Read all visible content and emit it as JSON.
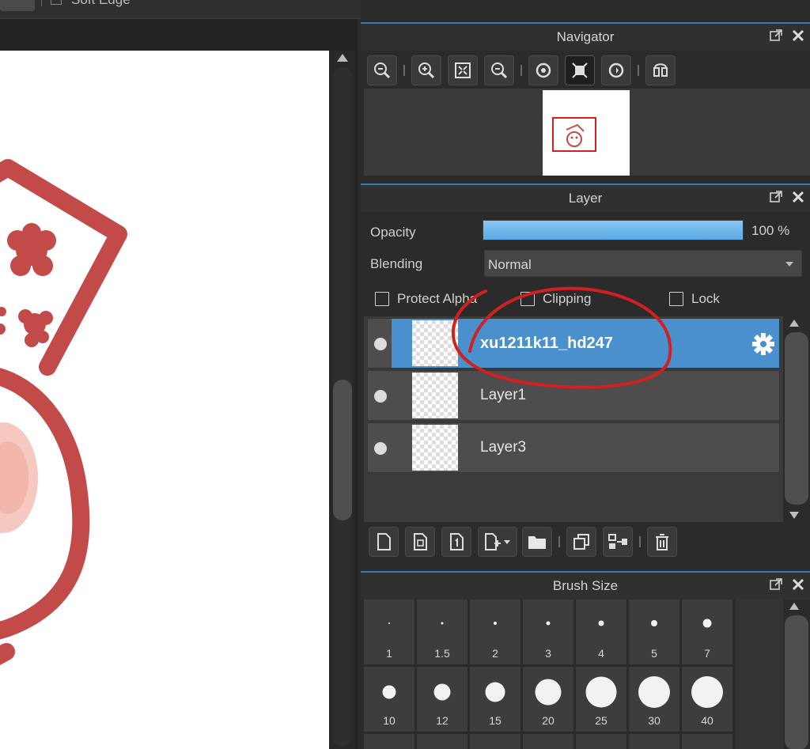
{
  "toolbar_top": {
    "soft_edge_label": "Soft Edge"
  },
  "navigator": {
    "title": "Navigator",
    "tools": [
      "zoom-fit-icon",
      "zoom-in-icon",
      "fit-screen-icon",
      "zoom-out-icon",
      "rotate-left-icon",
      "actual-size-icon",
      "rotate-right-icon",
      "flip-icon"
    ]
  },
  "layer": {
    "title": "Layer",
    "opacity_label": "Opacity",
    "opacity_value": "100 %",
    "opacity_fraction": 1.0,
    "blending_label": "Blending",
    "blending_value": "Normal",
    "protect_alpha_label": "Protect Alpha",
    "clipping_label": "Clipping",
    "lock_label": "Lock",
    "layers": [
      {
        "name": "xu1211k11_hd247",
        "selected": true
      },
      {
        "name": "Layer1",
        "selected": false
      },
      {
        "name": "Layer3",
        "selected": false
      }
    ]
  },
  "brush_size": {
    "title": "Brush Size",
    "sizes": [
      "1",
      "1.5",
      "2",
      "3",
      "4",
      "5",
      "7",
      "10",
      "12",
      "15",
      "20",
      "25",
      "30",
      "40"
    ]
  },
  "colors": {
    "accent": "#4a90cd",
    "annotation_red": "#d02020",
    "sketch_red": "#c24a48"
  }
}
